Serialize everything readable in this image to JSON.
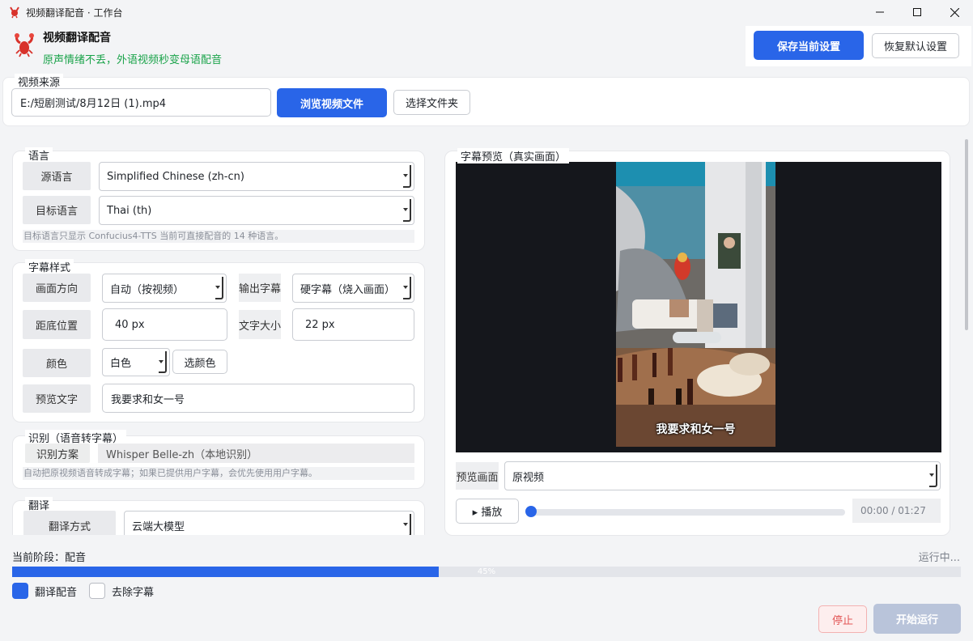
{
  "window": {
    "title": "视频翻译配音 · 工作台",
    "controls": [
      "minimize",
      "maximize",
      "close"
    ]
  },
  "header": {
    "app_name": "视频翻译配音",
    "slogan": "原声情绪不丢，外语视频秒变母语配音",
    "save_label": "保存当前设置",
    "reset_label": "恢复默认设置"
  },
  "source": {
    "group_title": "视频来源",
    "path_value": "E:/短剧测试/8月12日 (1).mp4",
    "browse_label": "浏览视频文件",
    "folder_label": "选择文件夹"
  },
  "language": {
    "group_title": "语言",
    "source_label": "源语言",
    "source_value": "Simplified Chinese (zh-cn)",
    "target_label": "目标语言",
    "target_value": "Thai (th)",
    "hint": "目标语言只显示 Confucius4-TTS 当前可直接配音的 14 种语言。"
  },
  "subtitle_style": {
    "group_title": "字幕样式",
    "orientation_label": "画面方向",
    "orientation_value": "自动（按视频）",
    "output_label": "输出字幕",
    "output_value": "硬字幕（烧入画面）",
    "bottom_label": "距底位置",
    "bottom_value": "40 px",
    "font_size_label": "文字大小",
    "font_size_value": "22 px",
    "color_label": "颜色",
    "color_value": "白色",
    "pick_color_label": "选颜色",
    "preview_text_label": "预览文字",
    "preview_text_value": "我要求和女一号"
  },
  "recognition": {
    "group_title": "识别（语音转字幕）",
    "scheme_label": "识别方案",
    "scheme_value": "Whisper Belle-zh（本地识别）",
    "hint": "自动把原视频语音转成字幕；如果已提供用户字幕，会优先使用用户字幕。"
  },
  "translation": {
    "group_title": "翻译",
    "mode_label": "翻译方式",
    "mode_value": "云端大模型"
  },
  "preview": {
    "group_title": "字幕预览（真实画面）",
    "subtitle_text": "我要求和女一号",
    "screen_label": "预览画面",
    "screen_value": "原视频",
    "play_label": "▸ 播放",
    "time": "00:00 / 01:27",
    "position_fraction": 0
  },
  "footer": {
    "stage": "当前阶段：配音",
    "status": "运行中...",
    "progress_percent": 45,
    "progress_text": "45%",
    "dub_label": "翻译配音",
    "dub_checked": true,
    "remove_sub_label": "去除字幕",
    "remove_sub_checked": false,
    "stop_label": "停止",
    "run_label": "开始运行"
  },
  "colors": {
    "accent": "#2965e8",
    "slogan_green": "#1aa34a",
    "stop_red": "#e25555",
    "run_disabled": "#b9c4da"
  }
}
